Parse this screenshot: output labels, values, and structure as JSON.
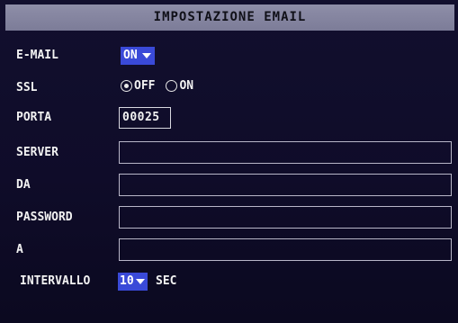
{
  "title": "IMPOSTAZIONE EMAIL",
  "email": {
    "label": "E-MAIL",
    "value": "ON"
  },
  "ssl": {
    "label": "SSL",
    "options": [
      {
        "label": "OFF",
        "selected": true
      },
      {
        "label": "ON",
        "selected": false
      }
    ]
  },
  "port": {
    "label": "PORTA",
    "value": "00025"
  },
  "server": {
    "label": "SERVER",
    "value": ""
  },
  "from": {
    "label": "DA",
    "value": ""
  },
  "password": {
    "label": "PASSWORD",
    "value": ""
  },
  "to": {
    "label": "A",
    "value": ""
  },
  "interval": {
    "label": "INTERVALLO",
    "value": "10",
    "unit": "SEC"
  },
  "colors": {
    "title_bar": "#8888a4",
    "background": "#0f0c29",
    "dropdown": "#3a4ad8",
    "field_border": "#b8b6c8",
    "text": "#f2f2f2"
  },
  "icons": {
    "dropdown_arrow": "chevron-down-icon",
    "radio": "radio-button-icon"
  }
}
